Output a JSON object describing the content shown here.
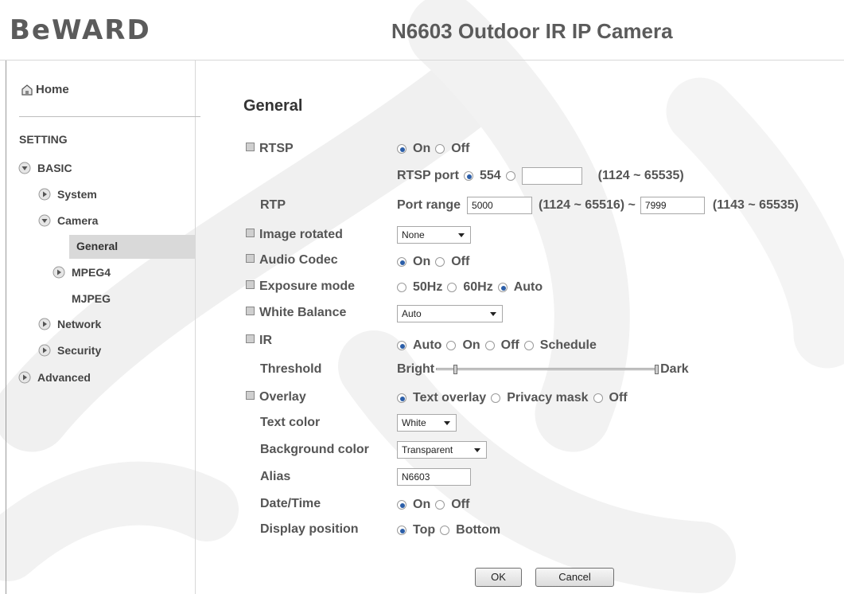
{
  "header": {
    "logo": "BeWARD",
    "camera_title": "N6603 Outdoor IR IP Camera"
  },
  "sidebar": {
    "home": "Home",
    "setting": "SETTING",
    "basic": "BASIC",
    "system": "System",
    "camera": "Camera",
    "general": "General",
    "mpeg4": "MPEG4",
    "mjpeg": "MJPEG",
    "network": "Network",
    "security": "Security",
    "advanced": "Advanced"
  },
  "form": {
    "title": "General",
    "rtsp": {
      "label": "RTSP",
      "on": "On",
      "off": "Off",
      "selected": "On",
      "port_label": "RTSP port",
      "port_default": "554",
      "port_custom_value": "",
      "port_range": "(1124 ~ 65535)"
    },
    "rtp": {
      "label": "RTP",
      "port_range_label": "Port range",
      "from": "5000",
      "from_range": "(1124 ~ 65516) ~",
      "to": "7999",
      "to_range": "(1143 ~ 65535)"
    },
    "image_rotated": {
      "label": "Image rotated",
      "value": "None"
    },
    "audio_codec": {
      "label": "Audio Codec",
      "on": "On",
      "off": "Off",
      "selected": "On"
    },
    "exposure_mode": {
      "label": "Exposure mode",
      "opt1": "50Hz",
      "opt2": "60Hz",
      "opt3": "Auto",
      "selected": "Auto"
    },
    "white_balance": {
      "label": "White Balance",
      "value": "Auto"
    },
    "ir": {
      "label": "IR",
      "opt1": "Auto",
      "opt2": "On",
      "opt3": "Off",
      "opt4": "Schedule",
      "selected": "Auto"
    },
    "threshold": {
      "label": "Threshold",
      "left": "Bright",
      "right": "Dark",
      "knob_left_pct": 0.08,
      "knob_right_pct": 1.0
    },
    "overlay": {
      "label": "Overlay",
      "opt1": "Text overlay",
      "opt2": "Privacy mask",
      "opt3": "Off",
      "selected": "Text overlay"
    },
    "text_color": {
      "label": "Text color",
      "value": "White"
    },
    "background_color": {
      "label": "Background color",
      "value": "Transparent"
    },
    "alias": {
      "label": "Alias",
      "value": "N6603"
    },
    "date_time": {
      "label": "Date/Time",
      "on": "On",
      "off": "Off",
      "selected": "On"
    },
    "display_position": {
      "label": "Display position",
      "top": "Top",
      "bottom": "Bottom",
      "selected": "Top"
    },
    "ok": "OK",
    "cancel": "Cancel"
  },
  "icons": {
    "home": "home-icon",
    "expanded": "chevron-down-icon",
    "collapsed": "chevron-right-icon",
    "bullet": "square-bullet-icon"
  },
  "colors": {
    "accent_radio": "#2b5ea8",
    "active_nav_bg": "#d9d9d9"
  }
}
